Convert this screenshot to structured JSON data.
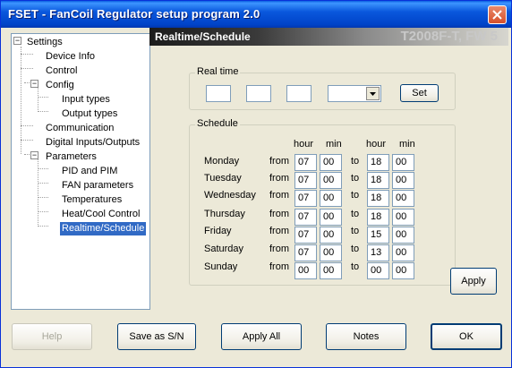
{
  "window": {
    "title": "FSET - FanCoil Regulator setup program 2.0"
  },
  "tree": {
    "items": [
      {
        "label": "Settings"
      },
      {
        "label": "Device Info"
      },
      {
        "label": "Control"
      },
      {
        "label": "Config"
      },
      {
        "label": "Input types"
      },
      {
        "label": "Output types"
      },
      {
        "label": "Communication"
      },
      {
        "label": "Digital Inputs/Outputs"
      },
      {
        "label": "Parameters"
      },
      {
        "label": "PID and PIM"
      },
      {
        "label": "FAN parameters"
      },
      {
        "label": "Temperatures"
      },
      {
        "label": "Heat/Cool Control"
      },
      {
        "label": "Realtime/Schedule"
      }
    ],
    "expand_sign": "−"
  },
  "panel": {
    "title": "Realtime/Schedule",
    "model": "T2008F-T, FW 5"
  },
  "realtime": {
    "label": "Real time",
    "field1": "",
    "field2": "",
    "field3": "",
    "combo": "",
    "set_button": "Set"
  },
  "schedule": {
    "label": "Schedule",
    "headers": {
      "hour": "hour",
      "min": "min"
    },
    "from_label": "from",
    "to_label": "to",
    "days": [
      {
        "name": "Monday",
        "from_h": "07",
        "from_m": "00",
        "to_h": "18",
        "to_m": "00"
      },
      {
        "name": "Tuesday",
        "from_h": "07",
        "from_m": "00",
        "to_h": "18",
        "to_m": "00"
      },
      {
        "name": "Wednesday",
        "from_h": "07",
        "from_m": "00",
        "to_h": "18",
        "to_m": "00"
      },
      {
        "name": "Thursday",
        "from_h": "07",
        "from_m": "00",
        "to_h": "18",
        "to_m": "00"
      },
      {
        "name": "Friday",
        "from_h": "07",
        "from_m": "00",
        "to_h": "15",
        "to_m": "00"
      },
      {
        "name": "Saturday",
        "from_h": "07",
        "from_m": "00",
        "to_h": "13",
        "to_m": "00"
      },
      {
        "name": "Sunday",
        "from_h": "00",
        "from_m": "00",
        "to_h": "00",
        "to_m": "00"
      }
    ]
  },
  "buttons": {
    "apply": "Apply",
    "help": "Help",
    "save_as": "Save as S/N",
    "apply_all": "Apply All",
    "notes": "Notes",
    "ok": "OK"
  },
  "colors": {
    "selection": "#316ac5",
    "titlebar": "#0a58dd",
    "close": "#d7502b"
  }
}
